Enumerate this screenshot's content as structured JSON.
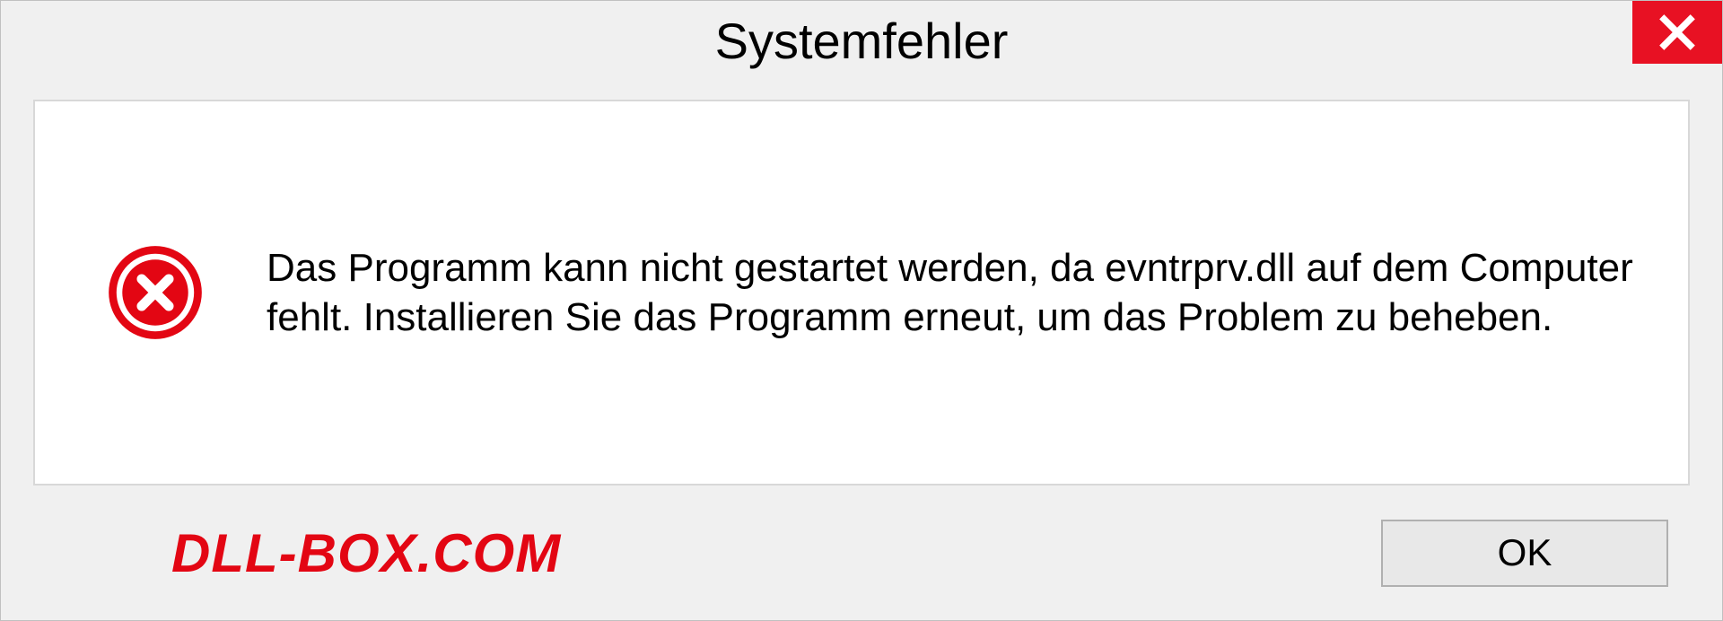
{
  "dialog": {
    "title": "Systemfehler",
    "message": "Das Programm kann nicht gestartet werden, da evntrprv.dll auf dem Computer fehlt. Installieren Sie das Programm erneut, um das Problem zu beheben.",
    "ok_label": "OK"
  },
  "watermark": "DLL-BOX.COM"
}
